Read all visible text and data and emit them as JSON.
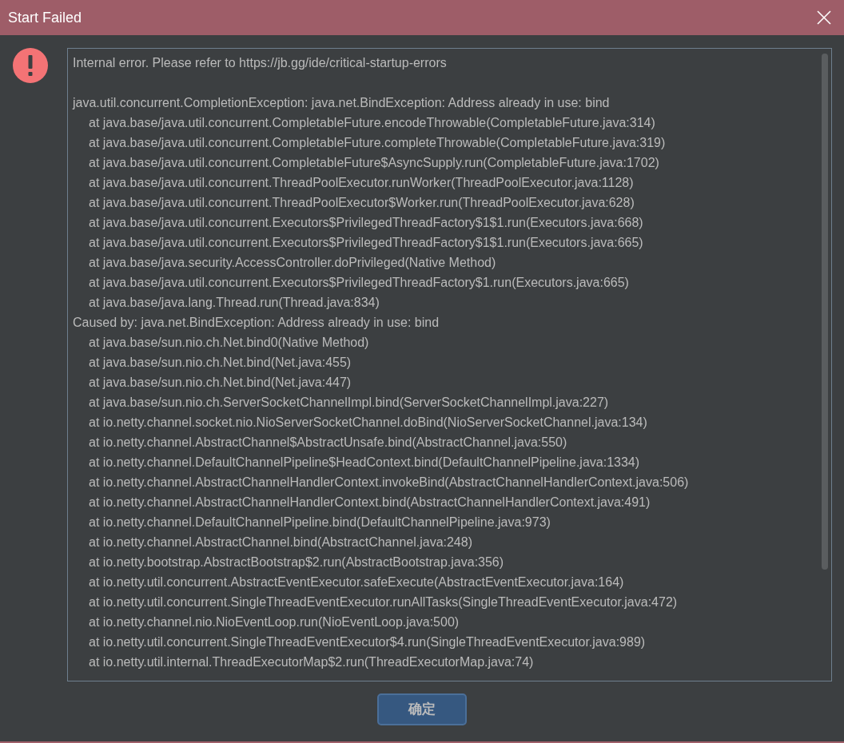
{
  "window": {
    "title": "Start Failed"
  },
  "message": "Internal error. Please refer to https://jb.gg/ide/critical-startup-errors",
  "sections": [
    {
      "heading": "java.util.concurrent.CompletionException: java.net.BindException: Address already in use: bind",
      "frames": [
        "at java.base/java.util.concurrent.CompletableFuture.encodeThrowable(CompletableFuture.java:314)",
        "at java.base/java.util.concurrent.CompletableFuture.completeThrowable(CompletableFuture.java:319)",
        "at java.base/java.util.concurrent.CompletableFuture$AsyncSupply.run(CompletableFuture.java:1702)",
        "at java.base/java.util.concurrent.ThreadPoolExecutor.runWorker(ThreadPoolExecutor.java:1128)",
        "at java.base/java.util.concurrent.ThreadPoolExecutor$Worker.run(ThreadPoolExecutor.java:628)",
        "at java.base/java.util.concurrent.Executors$PrivilegedThreadFactory$1$1.run(Executors.java:668)",
        "at java.base/java.util.concurrent.Executors$PrivilegedThreadFactory$1$1.run(Executors.java:665)",
        "at java.base/java.security.AccessController.doPrivileged(Native Method)",
        "at java.base/java.util.concurrent.Executors$PrivilegedThreadFactory$1.run(Executors.java:665)",
        "at java.base/java.lang.Thread.run(Thread.java:834)"
      ]
    },
    {
      "heading": "Caused by: java.net.BindException: Address already in use: bind",
      "frames": [
        "at java.base/sun.nio.ch.Net.bind0(Native Method)",
        "at java.base/sun.nio.ch.Net.bind(Net.java:455)",
        "at java.base/sun.nio.ch.Net.bind(Net.java:447)",
        "at java.base/sun.nio.ch.ServerSocketChannelImpl.bind(ServerSocketChannelImpl.java:227)",
        "at io.netty.channel.socket.nio.NioServerSocketChannel.doBind(NioServerSocketChannel.java:134)",
        "at io.netty.channel.AbstractChannel$AbstractUnsafe.bind(AbstractChannel.java:550)",
        "at io.netty.channel.DefaultChannelPipeline$HeadContext.bind(DefaultChannelPipeline.java:1334)",
        "at io.netty.channel.AbstractChannelHandlerContext.invokeBind(AbstractChannelHandlerContext.java:506)",
        "at io.netty.channel.AbstractChannelHandlerContext.bind(AbstractChannelHandlerContext.java:491)",
        "at io.netty.channel.DefaultChannelPipeline.bind(DefaultChannelPipeline.java:973)",
        "at io.netty.channel.AbstractChannel.bind(AbstractChannel.java:248)",
        "at io.netty.bootstrap.AbstractBootstrap$2.run(AbstractBootstrap.java:356)",
        "at io.netty.util.concurrent.AbstractEventExecutor.safeExecute(AbstractEventExecutor.java:164)",
        "at io.netty.util.concurrent.SingleThreadEventExecutor.runAllTasks(SingleThreadEventExecutor.java:472)",
        "at io.netty.channel.nio.NioEventLoop.run(NioEventLoop.java:500)",
        "at io.netty.util.concurrent.SingleThreadEventExecutor$4.run(SingleThreadEventExecutor.java:989)",
        "at io.netty.util.internal.ThreadExecutorMap$2.run(ThreadExecutorMap.java:74)"
      ]
    }
  ],
  "buttons": [
    {
      "label": "确定",
      "selected": true
    }
  ]
}
